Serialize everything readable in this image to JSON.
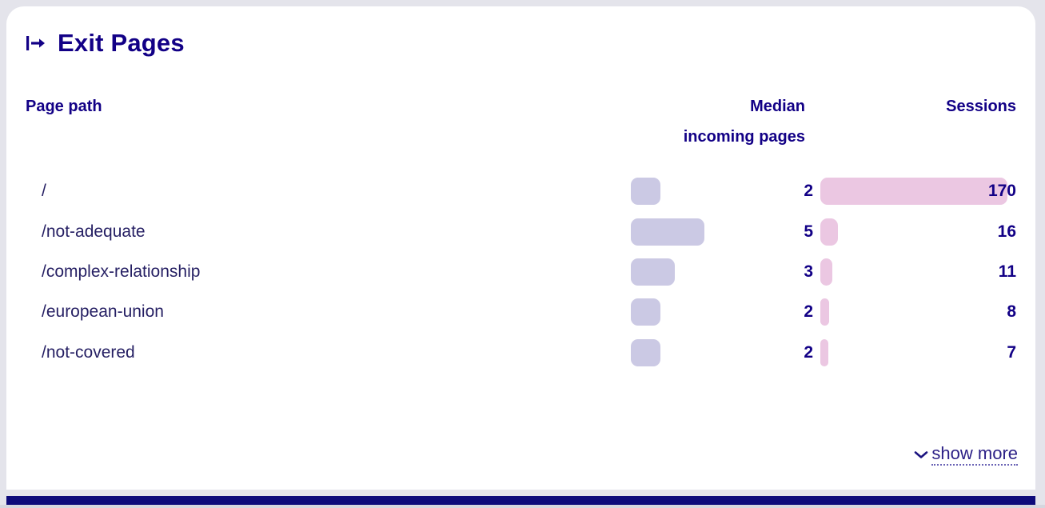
{
  "card": {
    "title": "Exit Pages",
    "title_icon": "exit-arrow-icon"
  },
  "table": {
    "columns": {
      "path": "Page path",
      "median_line1": "Median",
      "median_line2": "incoming pages",
      "sessions": "Sessions"
    },
    "rows": [
      {
        "path": "/",
        "median": "2",
        "sessions": "170"
      },
      {
        "path": "/not-adequate",
        "median": "5",
        "sessions": "16"
      },
      {
        "path": "/complex-relationship",
        "median": "3",
        "sessions": "11"
      },
      {
        "path": "/european-union",
        "median": "2",
        "sessions": "8"
      },
      {
        "path": "/not-covered",
        "median": "2",
        "sessions": "7"
      }
    ]
  },
  "footer": {
    "show_more": "show more",
    "show_more_icon": "chevron-down-icon"
  },
  "chart_data": {
    "type": "bar",
    "title": "Exit Pages",
    "orientation": "horizontal",
    "categories": [
      "/",
      "/not-adequate",
      "/complex-relationship",
      "/european-union",
      "/not-covered"
    ],
    "series": [
      {
        "name": "Median incoming pages",
        "values": [
          2,
          5,
          3,
          2,
          2
        ],
        "color": "#cbc9e4",
        "max": 5
      },
      {
        "name": "Sessions",
        "values": [
          170,
          16,
          11,
          8,
          7
        ],
        "color": "#ebc7e2",
        "max": 170
      }
    ],
    "xlabel": "",
    "ylabel": "Page path",
    "grid": false,
    "legend": "none"
  },
  "colors": {
    "accent_text": "#120086",
    "path_text": "#251f63",
    "median_bar": "#cbc9e4",
    "sessions_bar": "#ebc7e2",
    "page_bg": "#e4e4eb",
    "card_bg": "#ffffff",
    "bottom_bar": "#0d0a7a"
  }
}
